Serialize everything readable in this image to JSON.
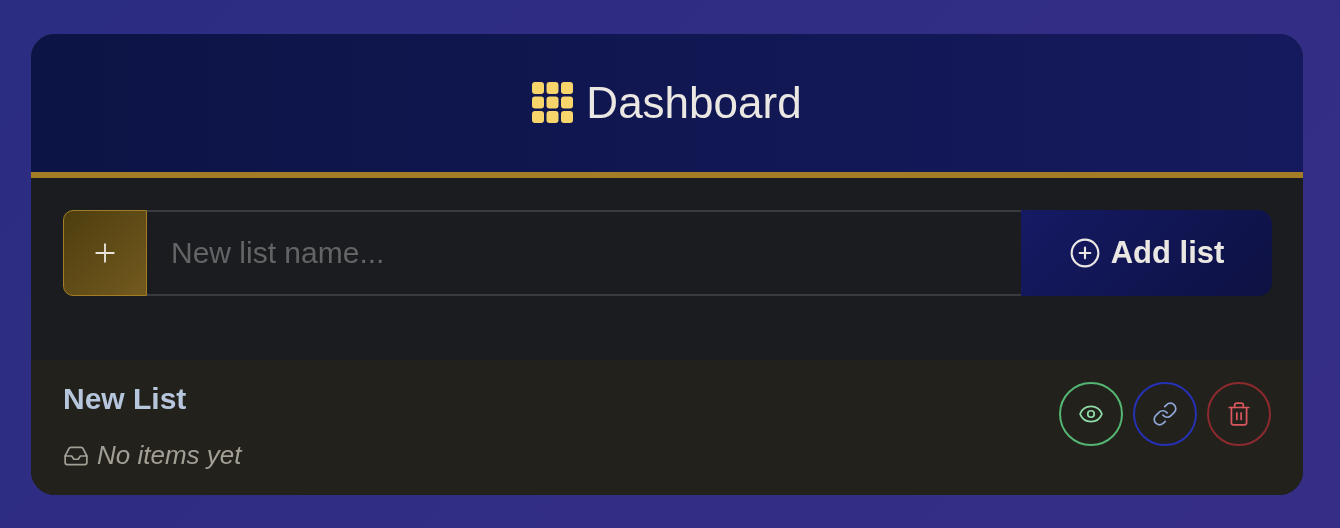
{
  "header": {
    "title": "Dashboard"
  },
  "new_list": {
    "placeholder": "New list name...",
    "button": "Add list"
  },
  "lists": [
    {
      "name": "New List",
      "empty_text": "No items yet",
      "actions": [
        {
          "kind": "view"
        },
        {
          "kind": "share"
        },
        {
          "kind": "delete"
        }
      ]
    }
  ]
}
